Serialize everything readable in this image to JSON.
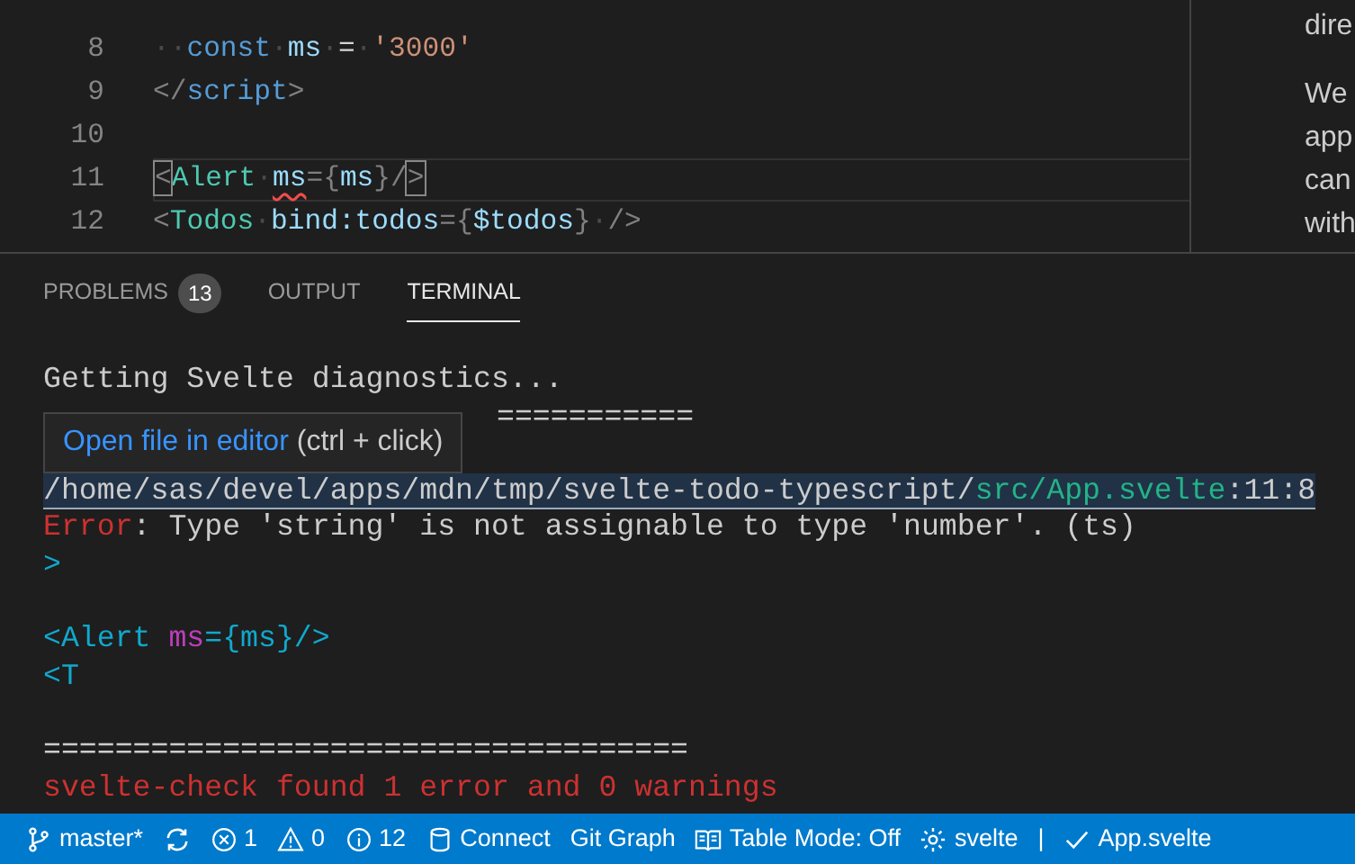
{
  "editor": {
    "lines": [
      {
        "number": "8",
        "current": false,
        "tokens": [
          {
            "text": "··",
            "kind": "ws"
          },
          {
            "text": "const",
            "kind": "keyword"
          },
          {
            "text": "·",
            "kind": "ws"
          },
          {
            "text": "ms",
            "kind": "variable"
          },
          {
            "text": "·",
            "kind": "ws"
          },
          {
            "text": "=",
            "kind": "plain"
          },
          {
            "text": "·",
            "kind": "ws"
          },
          {
            "text": "'3000'",
            "kind": "string"
          }
        ]
      },
      {
        "number": "9",
        "current": false,
        "tokens": [
          {
            "text": "</",
            "kind": "punct"
          },
          {
            "text": "script",
            "kind": "keyword"
          },
          {
            "text": ">",
            "kind": "punct"
          }
        ]
      },
      {
        "number": "10",
        "current": false
      },
      {
        "number": "11",
        "current": true,
        "tokens": [
          {
            "text": "<",
            "kind": "bracket"
          },
          {
            "text": "Alert",
            "kind": "tag"
          },
          {
            "text": "·",
            "kind": "ws"
          },
          {
            "text": "ms",
            "kind": "variable",
            "error": true
          },
          {
            "text": "={",
            "kind": "punct"
          },
          {
            "text": "ms",
            "kind": "variable"
          },
          {
            "text": "}",
            "kind": "punct"
          },
          {
            "text": "/",
            "kind": "punct"
          },
          {
            "text": ">",
            "kind": "bracket"
          }
        ]
      },
      {
        "number": "12",
        "current": false,
        "tokens": [
          {
            "text": "<",
            "kind": "punct"
          },
          {
            "text": "Todos",
            "kind": "tag"
          },
          {
            "text": "·",
            "kind": "ws"
          },
          {
            "text": "bind:todos",
            "kind": "variable"
          },
          {
            "text": "={",
            "kind": "punct"
          },
          {
            "text": "$todos",
            "kind": "variable"
          },
          {
            "text": "}",
            "kind": "punct"
          },
          {
            "text": "·",
            "kind": "ws"
          },
          {
            "text": "/>",
            "kind": "punct"
          }
        ]
      }
    ]
  },
  "preview": {
    "lines": [
      "dire",
      "We",
      "app",
      "can",
      "with"
    ]
  },
  "panel": {
    "tabs": [
      {
        "label": "PROBLEMS",
        "badge": "13",
        "selected": false
      },
      {
        "label": "OUTPUT",
        "selected": false
      },
      {
        "label": "TERMINAL",
        "selected": true
      }
    ],
    "terminal": [
      {
        "kind": "text",
        "tokens": [
          {
            "text": "Getting Svelte diagnostics...",
            "kind": "plain"
          }
        ]
      },
      {
        "kind": "covered",
        "tokens": [
          {
            "text": "===========",
            "kind": "plain"
          }
        ]
      },
      {
        "kind": "hidden"
      },
      {
        "kind": "link",
        "tokens": [
          {
            "text": "/home/sas/devel/apps/mdn/tmp/svelte-todo-typescript/",
            "kind": "plain"
          },
          {
            "text": "src/App.svelte",
            "kind": "green"
          },
          {
            "text": ":11:8",
            "kind": "plain"
          }
        ]
      },
      {
        "kind": "text",
        "tokens": [
          {
            "text": "Error",
            "kind": "red"
          },
          {
            "text": ": Type 'string' is not assignable to type 'number'. (ts)",
            "kind": "plain"
          }
        ]
      },
      {
        "kind": "text",
        "tokens": [
          {
            "text": ">",
            "kind": "cyan"
          }
        ]
      },
      {
        "kind": "blank"
      },
      {
        "kind": "text",
        "tokens": [
          {
            "text": "<Alert ",
            "kind": "cyan"
          },
          {
            "text": "ms",
            "kind": "magenta"
          },
          {
            "text": "={ms}/>",
            "kind": "cyan"
          }
        ]
      },
      {
        "kind": "text",
        "tokens": [
          {
            "text": "<T",
            "kind": "cyan"
          }
        ]
      },
      {
        "kind": "blank"
      },
      {
        "kind": "text",
        "tokens": [
          {
            "text": "====================================",
            "kind": "plain"
          }
        ]
      },
      {
        "kind": "text",
        "tokens": [
          {
            "text": "svelte-check found 1 error and 0 warnings",
            "kind": "red"
          }
        ]
      }
    ],
    "tooltip": {
      "link": "Open file in editor",
      "hint": "(ctrl + click)"
    }
  },
  "status_bar": [
    {
      "text": "master*"
    },
    {
      "kind": "icon"
    },
    {
      "text": "1"
    },
    {
      "text": "0"
    },
    {
      "text": "12"
    },
    {
      "text": "Connect"
    },
    {
      "text": "Git Graph"
    },
    {
      "text": "Table Mode: Off"
    },
    {
      "text": "svelte"
    },
    {
      "text": "|"
    },
    {
      "text": "App.svelte"
    }
  ]
}
